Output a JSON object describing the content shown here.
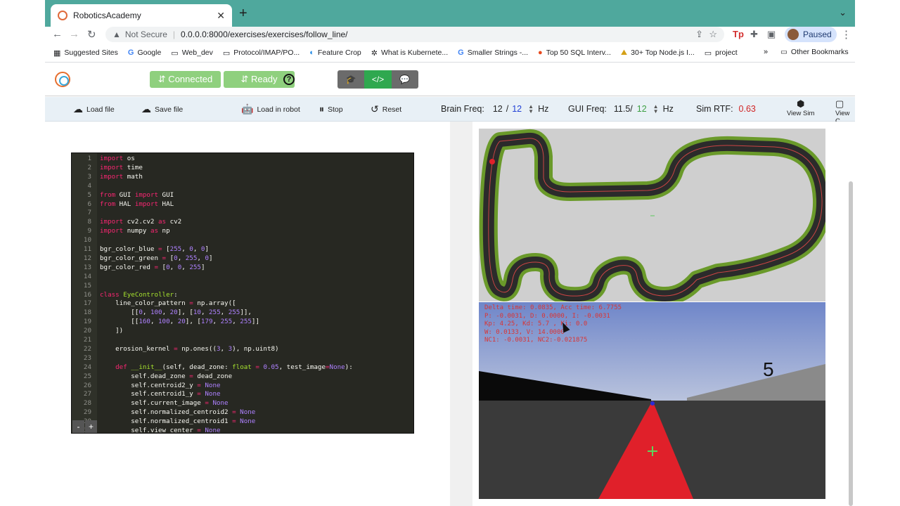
{
  "browser": {
    "tab_title": "RoboticsAcademy",
    "url_security": "Not Secure",
    "url": "0.0.0.0:8000/exercises/exercises/follow_line/",
    "profile_label": "Paused",
    "bookmarks": [
      {
        "icon": "grid-icon",
        "label": "Suggested Sites"
      },
      {
        "icon": "google-icon",
        "label": "Google"
      },
      {
        "icon": "folder-icon",
        "label": "Web_dev"
      },
      {
        "icon": "folder-icon",
        "label": "Protocol/IMAP/PO..."
      },
      {
        "icon": "crop-icon",
        "label": "Feature Crop"
      },
      {
        "icon": "kube-icon",
        "label": "What is Kubernete..."
      },
      {
        "icon": "google-icon",
        "label": "Smaller Strings -..."
      },
      {
        "icon": "g-icon",
        "label": "Top 50 SQL Interv..."
      },
      {
        "icon": "node-icon",
        "label": "30+ Top Node.js I..."
      },
      {
        "icon": "folder-icon",
        "label": "project"
      }
    ],
    "bookmarks_more": "»",
    "other_bookmarks": "Other Bookmarks"
  },
  "app": {
    "connected_label": "⇵ Connected",
    "ready_label": "⇵ Ready",
    "help_label": "?"
  },
  "toolbar": {
    "load_file": "Load file",
    "save_file": "Save file",
    "load_in_robot": "Load in robot",
    "stop": "Stop",
    "reset": "Reset",
    "brain_freq_label": "Brain Freq:",
    "brain_freq_value": "12",
    "brain_freq_target": "12",
    "brain_freq_unit": "Hz",
    "gui_freq_label": "GUI Freq:",
    "gui_freq_value": "11.5/",
    "gui_freq_target": "12",
    "gui_freq_unit": "Hz",
    "sim_rtf_label": "Sim RTF:",
    "sim_rtf_value": "0.63",
    "view_sim": "View Sim",
    "view_c": "View C"
  },
  "editor": {
    "lines": [
      [
        [
          "kw",
          "import"
        ],
        [
          "tx",
          " os"
        ]
      ],
      [
        [
          "kw",
          "import"
        ],
        [
          "tx",
          " time"
        ]
      ],
      [
        [
          "kw",
          "import"
        ],
        [
          "tx",
          " math"
        ]
      ],
      [],
      [
        [
          "kw",
          "from"
        ],
        [
          "tx",
          " GUI "
        ],
        [
          "kw",
          "import"
        ],
        [
          "tx",
          " GUI"
        ]
      ],
      [
        [
          "kw",
          "from"
        ],
        [
          "tx",
          " HAL "
        ],
        [
          "kw",
          "import"
        ],
        [
          "tx",
          " HAL"
        ]
      ],
      [],
      [
        [
          "kw",
          "import"
        ],
        [
          "tx",
          " cv2.cv2 "
        ],
        [
          "kw",
          "as"
        ],
        [
          "tx",
          " cv2"
        ]
      ],
      [
        [
          "kw",
          "import"
        ],
        [
          "tx",
          " numpy "
        ],
        [
          "kw",
          "as"
        ],
        [
          "tx",
          " np"
        ]
      ],
      [],
      [
        [
          "tx",
          "bgr_color_blue "
        ],
        [
          "kw",
          "="
        ],
        [
          "tx",
          " ["
        ],
        [
          "num",
          "255"
        ],
        [
          "tx",
          ", "
        ],
        [
          "num",
          "0"
        ],
        [
          "tx",
          ", "
        ],
        [
          "num",
          "0"
        ],
        [
          "tx",
          "]"
        ]
      ],
      [
        [
          "tx",
          "bgr_color_green "
        ],
        [
          "kw",
          "="
        ],
        [
          "tx",
          " ["
        ],
        [
          "num",
          "0"
        ],
        [
          "tx",
          ", "
        ],
        [
          "num",
          "255"
        ],
        [
          "tx",
          ", "
        ],
        [
          "num",
          "0"
        ],
        [
          "tx",
          "]"
        ]
      ],
      [
        [
          "tx",
          "bgr_color_red "
        ],
        [
          "kw",
          "="
        ],
        [
          "tx",
          " ["
        ],
        [
          "num",
          "0"
        ],
        [
          "tx",
          ", "
        ],
        [
          "num",
          "0"
        ],
        [
          "tx",
          ", "
        ],
        [
          "num",
          "255"
        ],
        [
          "tx",
          "]"
        ]
      ],
      [],
      [],
      [
        [
          "kw",
          "class"
        ],
        [
          "tx",
          " "
        ],
        [
          "cls",
          "EyeController"
        ],
        [
          "tx",
          ":"
        ]
      ],
      [
        [
          "tx",
          "    line_color_pattern "
        ],
        [
          "kw",
          "="
        ],
        [
          "tx",
          " np.array(["
        ]
      ],
      [
        [
          "tx",
          "        [["
        ],
        [
          "num",
          "0"
        ],
        [
          "tx",
          ", "
        ],
        [
          "num",
          "100"
        ],
        [
          "tx",
          ", "
        ],
        [
          "num",
          "20"
        ],
        [
          "tx",
          "], ["
        ],
        [
          "num",
          "10"
        ],
        [
          "tx",
          ", "
        ],
        [
          "num",
          "255"
        ],
        [
          "tx",
          ", "
        ],
        [
          "num",
          "255"
        ],
        [
          "tx",
          "]],"
        ]
      ],
      [
        [
          "tx",
          "        [["
        ],
        [
          "num",
          "160"
        ],
        [
          "tx",
          ", "
        ],
        [
          "num",
          "100"
        ],
        [
          "tx",
          ", "
        ],
        [
          "num",
          "20"
        ],
        [
          "tx",
          "], ["
        ],
        [
          "num",
          "179"
        ],
        [
          "tx",
          ", "
        ],
        [
          "num",
          "255"
        ],
        [
          "tx",
          ", "
        ],
        [
          "num",
          "255"
        ],
        [
          "tx",
          "]]"
        ]
      ],
      [
        [
          "tx",
          "    ])"
        ]
      ],
      [],
      [
        [
          "tx",
          "    erosion_kernel "
        ],
        [
          "kw",
          "="
        ],
        [
          "tx",
          " np.ones(("
        ],
        [
          "num",
          "3"
        ],
        [
          "tx",
          ", "
        ],
        [
          "num",
          "3"
        ],
        [
          "tx",
          "), np.uint8)"
        ]
      ],
      [],
      [
        [
          "tx",
          "    "
        ],
        [
          "kw",
          "def"
        ],
        [
          "tx",
          " "
        ],
        [
          "cls",
          "__init__"
        ],
        [
          "tx",
          "(self, dead_zone: "
        ],
        [
          "cls",
          "float"
        ],
        [
          "tx",
          " "
        ],
        [
          "kw",
          "="
        ],
        [
          "tx",
          " "
        ],
        [
          "num",
          "0.05"
        ],
        [
          "tx",
          ", test_image"
        ],
        [
          "kw",
          "="
        ],
        [
          "num",
          "None"
        ],
        [
          "tx",
          "):"
        ]
      ],
      [
        [
          "tx",
          "        self.dead_zone "
        ],
        [
          "kw",
          "="
        ],
        [
          "tx",
          " dead_zone"
        ]
      ],
      [
        [
          "tx",
          "        self.centroid2_y "
        ],
        [
          "kw",
          "="
        ],
        [
          "tx",
          " "
        ],
        [
          "num",
          "None"
        ]
      ],
      [
        [
          "tx",
          "        self.centroid1_y "
        ],
        [
          "kw",
          "="
        ],
        [
          "tx",
          " "
        ],
        [
          "num",
          "None"
        ]
      ],
      [
        [
          "tx",
          "        self.current_image "
        ],
        [
          "kw",
          "="
        ],
        [
          "tx",
          " "
        ],
        [
          "num",
          "None"
        ]
      ],
      [
        [
          "tx",
          "        self.normalized_centroid2 "
        ],
        [
          "kw",
          "="
        ],
        [
          "tx",
          " "
        ],
        [
          "num",
          "None"
        ]
      ],
      [
        [
          "tx",
          "        self.normalized_centroid1 "
        ],
        [
          "kw",
          "="
        ],
        [
          "tx",
          " "
        ],
        [
          "num",
          "None"
        ]
      ],
      [
        [
          "tx",
          "        self.view_center "
        ],
        [
          "kw",
          "="
        ],
        [
          "tx",
          " "
        ],
        [
          "num",
          "None"
        ]
      ]
    ],
    "zoom_out": "-",
    "zoom_in": "+"
  },
  "camera": {
    "telemetry": [
      "Delta time: 0.0835, Acc time: 6.7755",
      "P: -0.0031, D: 0.0000, I: -0.0031",
      "Kp: 4.25, Kd: 5.7 , Ki: 0.0",
      "W: 0.0133, V: 14.0000",
      "NC1: -0.0031, NC2:-0.021875"
    ],
    "sign_number": "5"
  },
  "colors": {
    "tab_strip": "#4fa89d",
    "button_green": "#8fd07e",
    "mode_dark": "#6b6b6b",
    "mode_active": "#2fa84f",
    "editor_bg": "#272822",
    "track_green": "#6a9a2a",
    "line_red": "#e0202a"
  }
}
